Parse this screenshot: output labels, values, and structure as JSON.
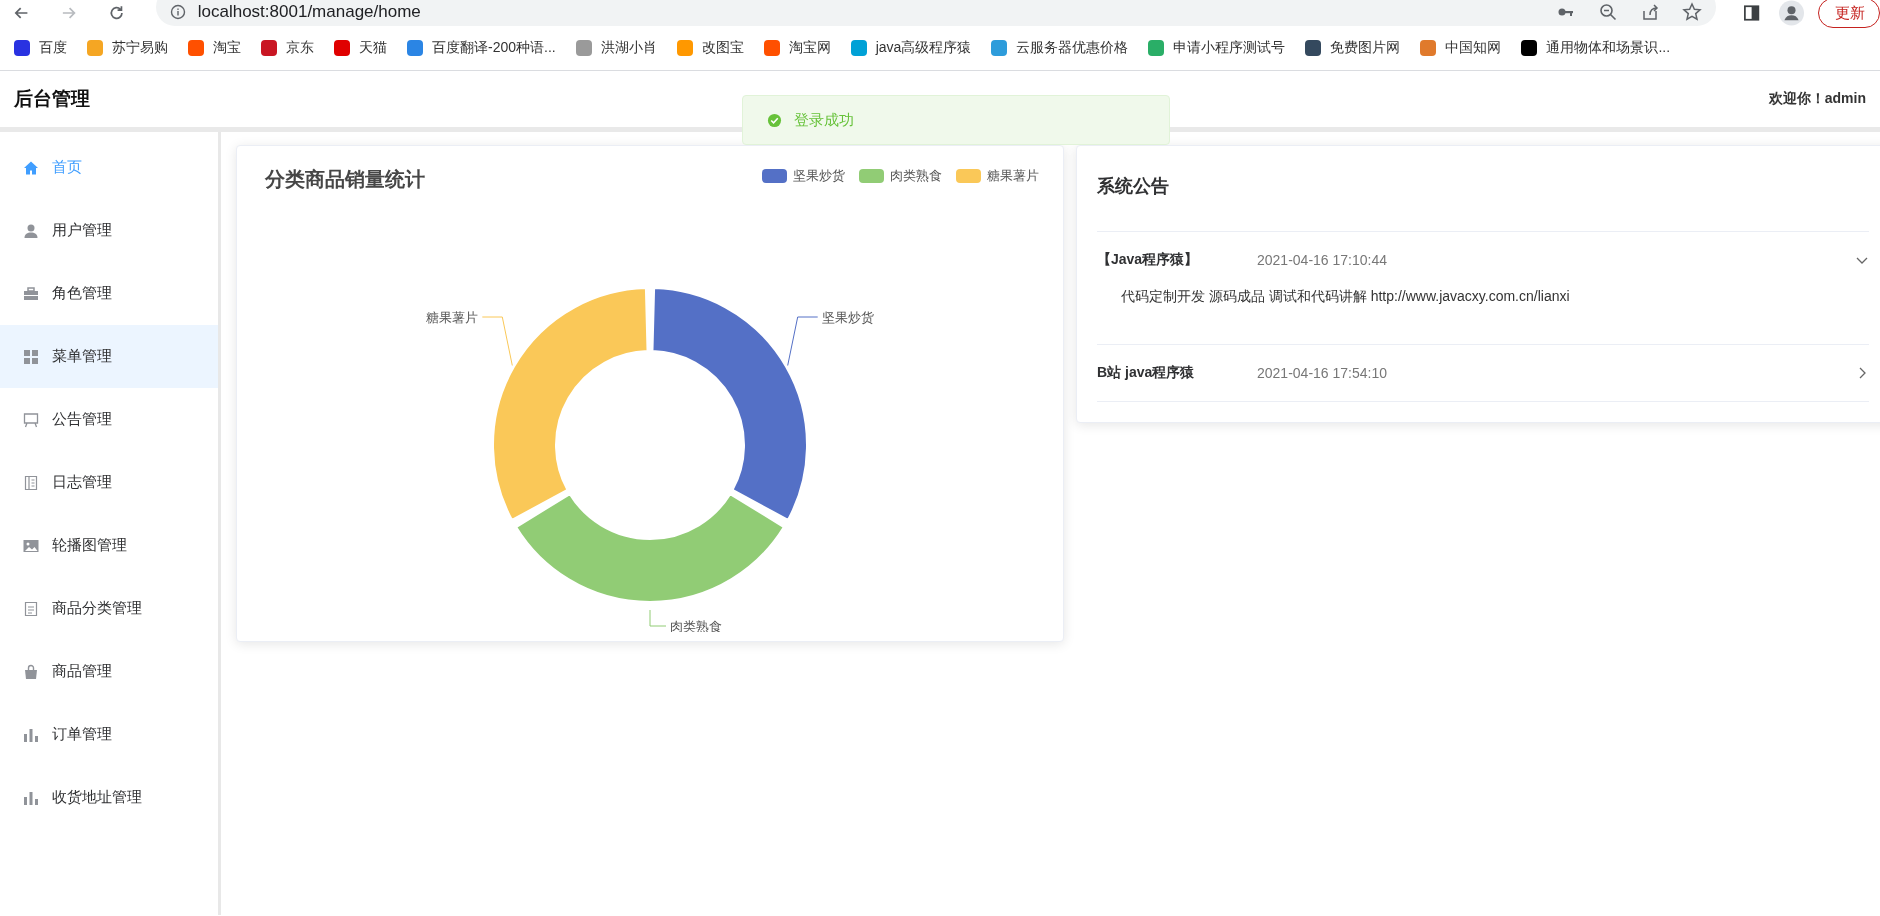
{
  "browser": {
    "url": "localhost:8001/manage/home",
    "update_button": "更新"
  },
  "bookmarks": [
    {
      "label": "百度",
      "color": "#2932e1"
    },
    {
      "label": "苏宁易购",
      "color": "#f5a623"
    },
    {
      "label": "淘宝",
      "color": "#ff5000"
    },
    {
      "label": "京东",
      "color": "#c91623"
    },
    {
      "label": "天猫",
      "color": "#e00000"
    },
    {
      "label": "百度翻译-200种语...",
      "color": "#2b85e4"
    },
    {
      "label": "洪湖小肖",
      "color": "#9a9a9a"
    },
    {
      "label": "改图宝",
      "color": "#ff9800"
    },
    {
      "label": "淘宝网",
      "color": "#ff5000"
    },
    {
      "label": "java高级程序猿",
      "color": "#00a1d6"
    },
    {
      "label": "云服务器优惠价格",
      "color": "#2d9cdb"
    },
    {
      "label": "申请小程序测试号",
      "color": "#2aae67"
    },
    {
      "label": "免费图片网",
      "color": "#34495e"
    },
    {
      "label": "中国知网",
      "color": "#e07a2c"
    },
    {
      "label": "通用物体和场景识...",
      "color": "#000000"
    }
  ],
  "header": {
    "title": "后台管理",
    "welcome": "欢迎你！admin"
  },
  "toast": {
    "message": "登录成功"
  },
  "sidebar": {
    "items": [
      {
        "label": "首页",
        "kind": "home",
        "selected": true,
        "hovered": false
      },
      {
        "label": "用户管理",
        "kind": "user",
        "selected": false,
        "hovered": false
      },
      {
        "label": "角色管理",
        "kind": "briefcase",
        "selected": false,
        "hovered": false
      },
      {
        "label": "菜单管理",
        "kind": "grid",
        "selected": false,
        "hovered": true
      },
      {
        "label": "公告管理",
        "kind": "board",
        "selected": false,
        "hovered": false
      },
      {
        "label": "日志管理",
        "kind": "notebook",
        "selected": false,
        "hovered": false
      },
      {
        "label": "轮播图管理",
        "kind": "picture",
        "selected": false,
        "hovered": false
      },
      {
        "label": "商品分类管理",
        "kind": "document",
        "selected": false,
        "hovered": false
      },
      {
        "label": "商品管理",
        "kind": "bag",
        "selected": false,
        "hovered": false
      },
      {
        "label": "订单管理",
        "kind": "bars",
        "selected": false,
        "hovered": false
      },
      {
        "label": "收货地址管理",
        "kind": "bars",
        "selected": false,
        "hovered": false
      }
    ]
  },
  "sales_chart": {
    "title": "分类商品销量统计",
    "series": [
      {
        "legend_label": "坚果炒货",
        "slice_label": "坚果炒货",
        "color": "#5470c6"
      },
      {
        "legend_label": "肉类熟食",
        "slice_label": "肉类熟食",
        "color": "#91cc75"
      },
      {
        "legend_label": "糖果薯片",
        "slice_label": "糖果薯片",
        "color": "#fac858"
      }
    ]
  },
  "notices": {
    "title": "系统公告",
    "items": [
      {
        "title": "【Java程序猿】",
        "time": "2021-04-16 17:10:44",
        "expanded": true,
        "content": "代码定制开发 源码成品 调试和代码讲解 http://www.javacxy.com.cn/lianxi"
      },
      {
        "title": "B站 java程序猿",
        "time": "2021-04-16 17:54:10",
        "expanded": false
      }
    ]
  }
}
